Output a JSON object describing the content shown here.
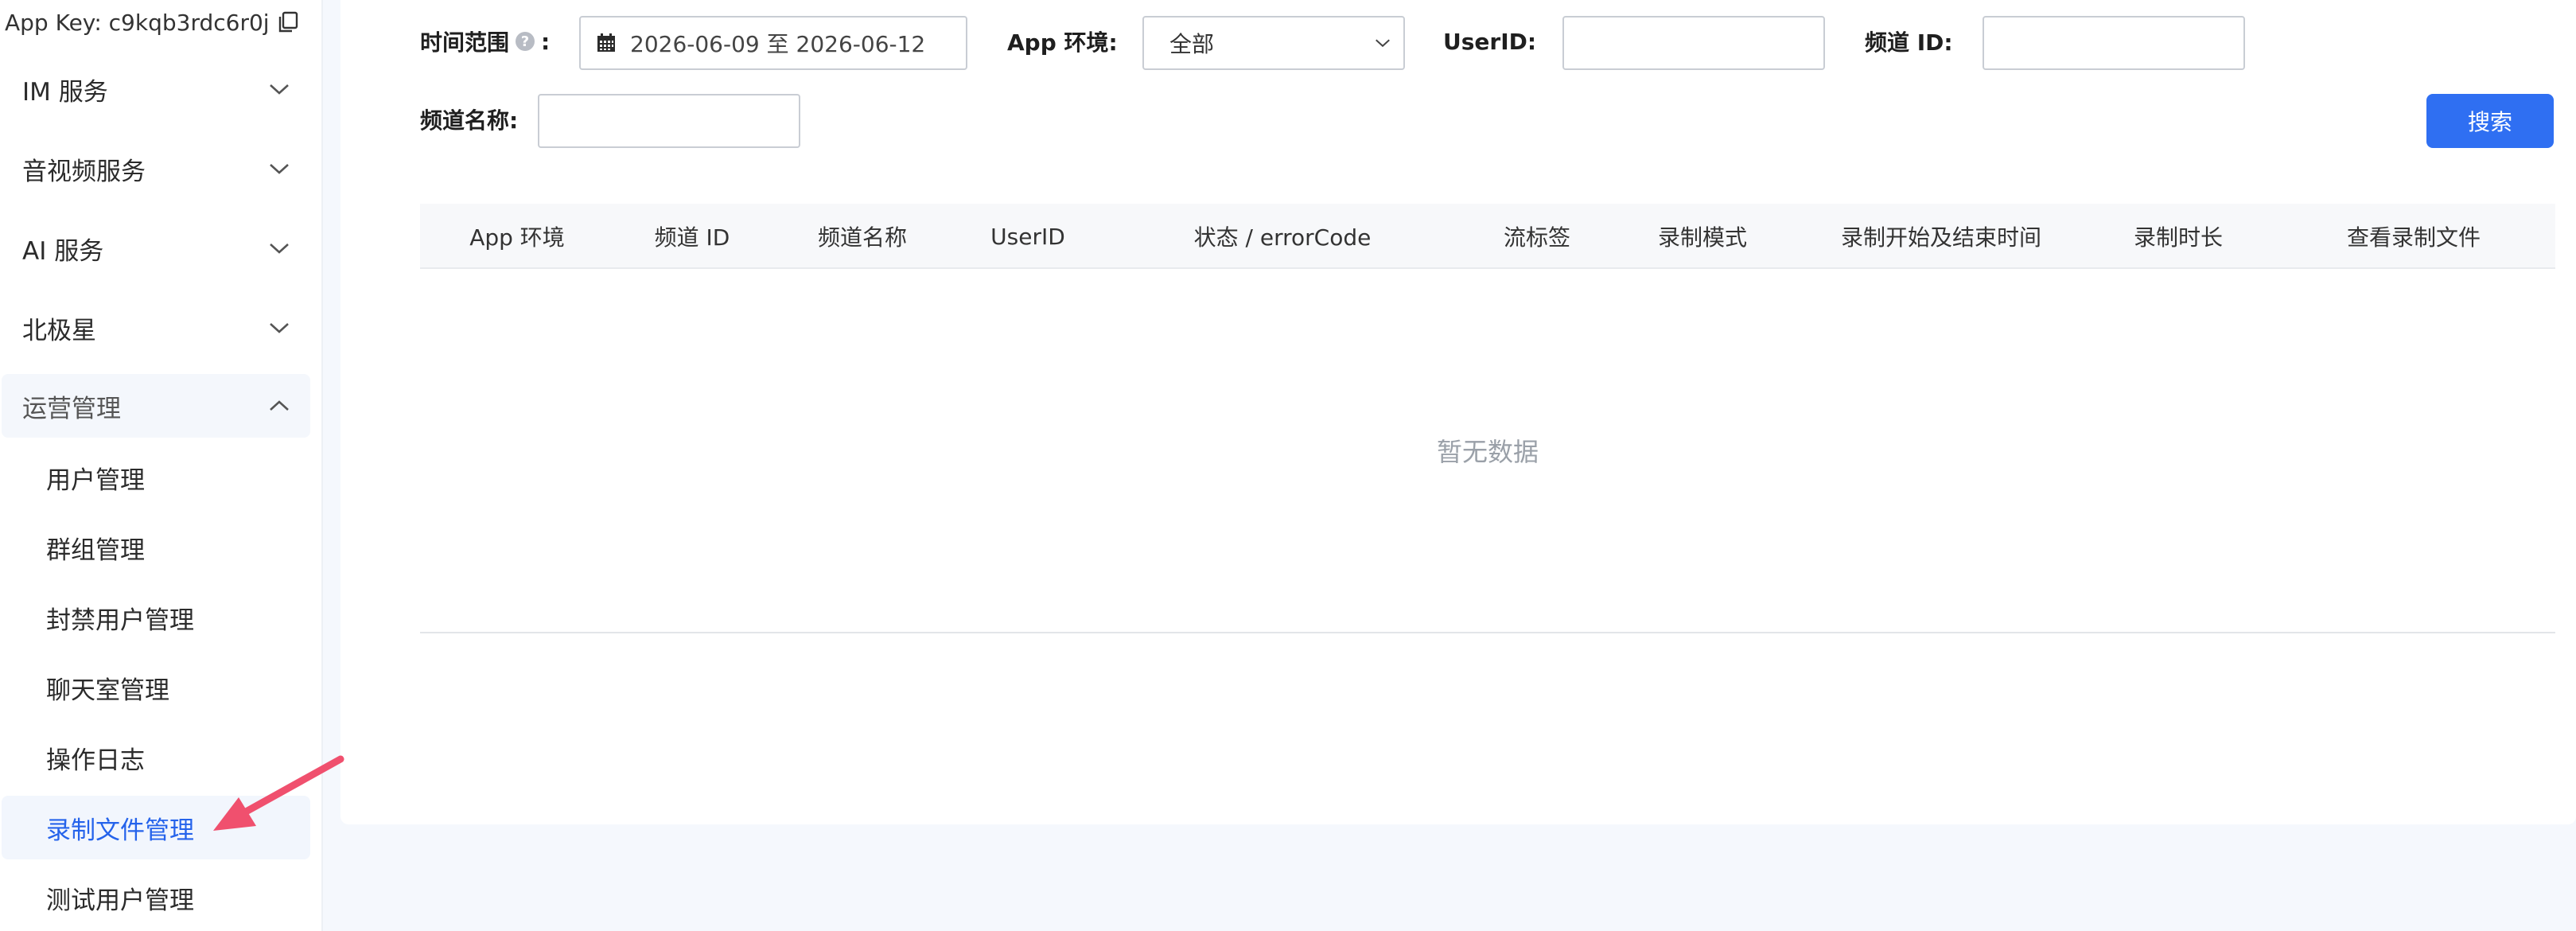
{
  "sidebar": {
    "app_key_label": "App Key: c9kqb3rdc6r0j",
    "groups": [
      {
        "label": "IM 服务"
      },
      {
        "label": "音视频服务"
      },
      {
        "label": "AI 服务"
      },
      {
        "label": "北极星"
      },
      {
        "label": "运营管理"
      }
    ],
    "sub_items": [
      {
        "label": "用户管理"
      },
      {
        "label": "群组管理"
      },
      {
        "label": "封禁用户管理"
      },
      {
        "label": "聊天室管理"
      },
      {
        "label": "操作日志"
      },
      {
        "label": "录制文件管理"
      },
      {
        "label": "测试用户管理"
      }
    ],
    "active_item": "录制文件管理"
  },
  "filters": {
    "time_range_label": "时间范围",
    "time_range_colon": ":",
    "time_range_value": "2026-06-09 至 2026-06-12",
    "app_env_label": "App 环境:",
    "app_env_value": "全部",
    "userid_label": "UserID:",
    "userid_value": "",
    "channel_id_label": "频道 ID:",
    "channel_id_value": "",
    "channel_name_label": "频道名称:",
    "channel_name_value": ""
  },
  "search_button_label": "搜索",
  "table": {
    "columns": [
      "App 环境",
      "频道 ID",
      "频道名称",
      "UserID",
      "状态 / errorCode",
      "流标签",
      "录制模式",
      "录制开始及结束时间",
      "录制时长",
      "查看录制文件"
    ],
    "empty_text": "暂无数据"
  },
  "colors": {
    "accent": "#2f6ff2",
    "active_text": "#2563eb",
    "annotation_arrow": "#f0506e"
  },
  "icons": {
    "copy": "copy-icon",
    "chevron_down": "chevron-down-icon",
    "chevron_up": "chevron-up-icon",
    "calendar": "calendar-icon",
    "help": "help-icon",
    "annotation": "arrow-icon"
  }
}
